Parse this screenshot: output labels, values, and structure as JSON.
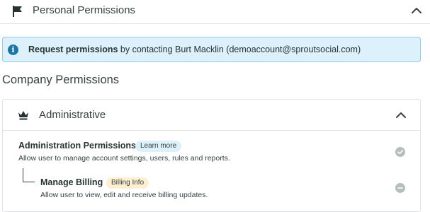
{
  "personal_permissions": {
    "title": "Personal Permissions",
    "icon": "flag-icon",
    "toggle_icon": "chevron-up-icon"
  },
  "info_banner": {
    "icon": "info-icon",
    "icon_glyph": "i",
    "bold_text": "Request permissions",
    "text": " by contacting Burt Macklin (demoaccount@sproutsocial.com)"
  },
  "company_permissions": {
    "title": "Company Permissions",
    "sections": [
      {
        "title": "Administrative",
        "icon": "crown-icon",
        "toggle_icon": "chevron-up-icon",
        "permissions": [
          {
            "name": "Administration Permissions",
            "badge": "Learn more",
            "badge_color": "#dcf1fb",
            "description": "Allow user to manage account settings, users, rules and reports.",
            "status": "granted",
            "status_icon": "check-circle-icon"
          },
          {
            "name": "Manage Billing",
            "badge": "Billing Info",
            "badge_color": "#fdefd0",
            "description": "Allow user to view, edit and receive billing updates.",
            "status": "not-granted",
            "status_icon": "minus-circle-icon"
          }
        ]
      }
    ]
  },
  "colors": {
    "banner_bg": "#dcf1fb",
    "banner_border": "#8ccbe9",
    "info_icon": "#1977a6",
    "status_icon": "#b7bebe",
    "text": "#364141"
  }
}
